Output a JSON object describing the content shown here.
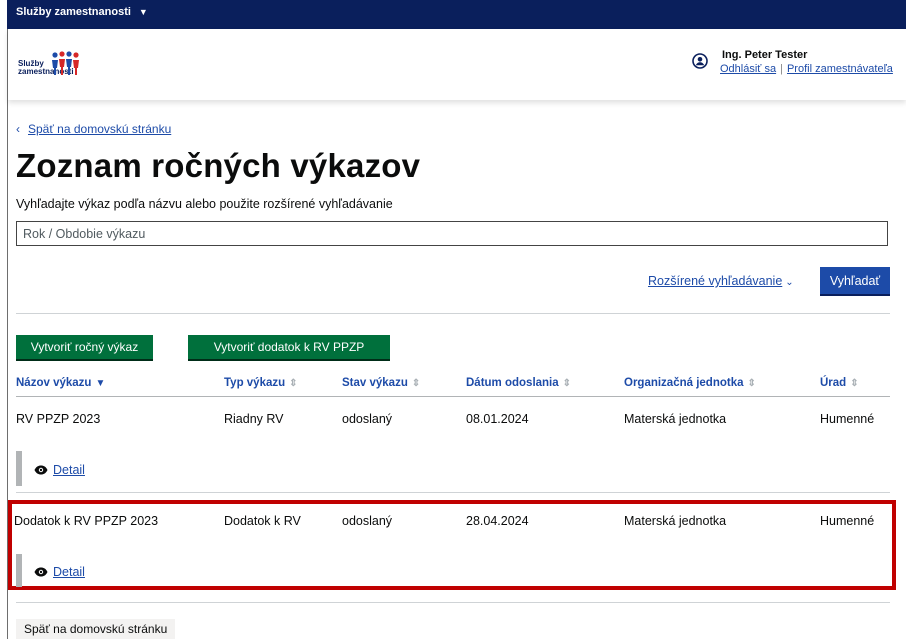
{
  "topbar": {
    "label": "Služby zamestnanosti"
  },
  "header": {
    "logo_text_line1": "Služby",
    "logo_text_line2": "zamestnanosti",
    "user_name": "Ing. Peter Tester",
    "logout_label": "Odhlásiť sa",
    "profile_label": "Profil zamestnávateľa"
  },
  "page": {
    "back_link": "Späť na domovskú stránku",
    "title": "Zoznam ročných výkazov",
    "hint": "Vyhľadajte výkaz podľa názvu alebo použite rozšírené vyhľadávanie",
    "search_placeholder": "Rok / Obdobie výkazu",
    "advanced_search_label": "Rozšírené vyhľadávanie",
    "search_button": "Vyhľadať",
    "create_report_button": "Vytvoriť ročný výkaz",
    "create_amendment_button": "Vytvoriť dodatok k RV PPZP",
    "back_button": "Späť na domovskú stránku"
  },
  "table": {
    "headers": [
      "Názov výkazu",
      "Typ výkazu",
      "Stav výkazu",
      "Dátum odoslania",
      "Organizačná jednotka",
      "Úrad"
    ],
    "rows": [
      {
        "name": "RV PPZP 2023",
        "type": "Riadny RV",
        "status": "odoslaný",
        "date": "08.01.2024",
        "unit": "Materská jednotka",
        "office": "Humenné",
        "detail": "Detail"
      },
      {
        "name": "Dodatok k RV PPZP 2023",
        "type": "Dodatok k RV",
        "status": "odoslaný",
        "date": "28.04.2024",
        "unit": "Materská jednotka",
        "office": "Humenné",
        "detail": "Detail"
      }
    ]
  },
  "colors": {
    "topbar": "#0a1f5c",
    "link": "#1d4ba8",
    "primary_button": "#1d4ba8",
    "green_button": "#00703c",
    "highlight": "#c00000"
  },
  "icons": [
    "caret-down-icon",
    "user-icon",
    "logo-icon",
    "chevron-left-icon",
    "sort-icon",
    "eye-icon"
  ]
}
